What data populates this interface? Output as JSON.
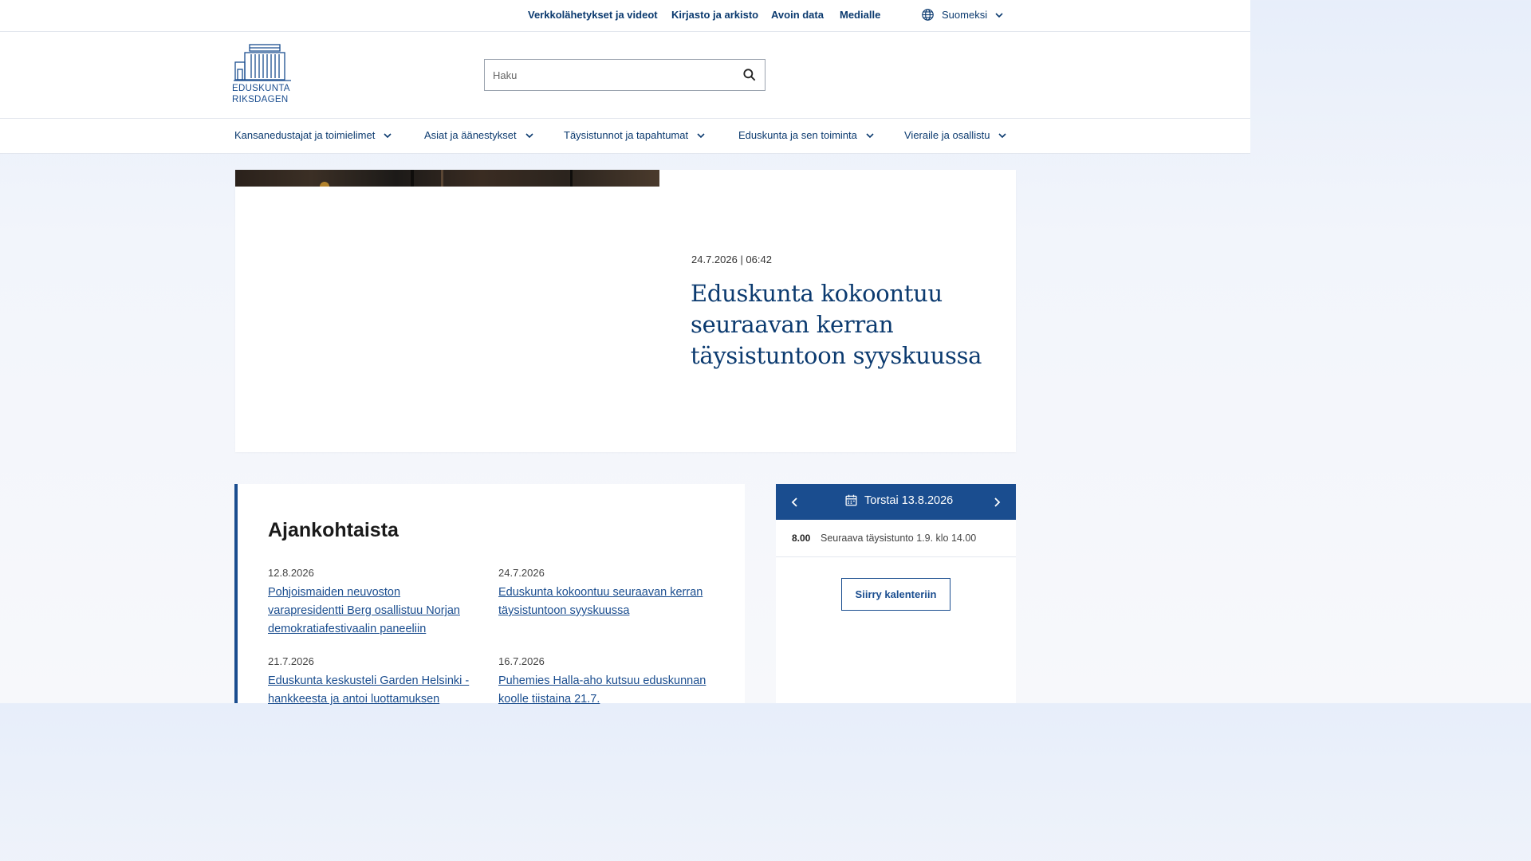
{
  "utility_nav": {
    "links": [
      "Verkkolähetykset ja videot",
      "Kirjasto ja arkisto",
      "Avoin data",
      "Medialle"
    ],
    "language": "Suomeksi"
  },
  "logo": {
    "line1": "EDUSKUNTA",
    "line2": "RIKSDAGEN"
  },
  "search": {
    "placeholder": "Haku"
  },
  "main_nav": {
    "items": [
      "Kansanedustajat ja toimielimet",
      "Asiat ja äänestykset",
      "Täysistunnot ja tapahtumat",
      "Eduskunta ja sen toiminta",
      "Vieraile ja osallistu"
    ]
  },
  "hero": {
    "datetime": "24.7.2026 | 06:42",
    "title": "Eduskunta kokoontuu seuraavan kerran täysistuntoon syyskuussa"
  },
  "news": {
    "heading": "Ajankohtaista",
    "items": [
      {
        "date": "12.8.2026",
        "title": "Pohjoismaiden neuvoston varapresidentti Berg osallistuu Norjan demokratiafestivaalin paneeliin"
      },
      {
        "date": "24.7.2026",
        "title": "Eduskunta kokoontuu seuraavan kerran täysistuntoon syyskuussa"
      },
      {
        "date": "21.7.2026",
        "title": "Eduskunta keskusteli Garden Helsinki -hankkeesta ja antoi luottamuksen"
      },
      {
        "date": "16.7.2026",
        "title": "Puhemies Halla-aho kutsuu eduskunnan koolle tiistaina 21.7."
      }
    ]
  },
  "calendar": {
    "date_label": "Torstai 13.8.2026",
    "event_time": "8.00",
    "event_text": "Seuraava täysistunto 1.9. klo 14.00",
    "button_label": "Siirry kalenteriin"
  },
  "colors": {
    "primary": "#1a4d8f",
    "link": "#0b3a6f"
  }
}
